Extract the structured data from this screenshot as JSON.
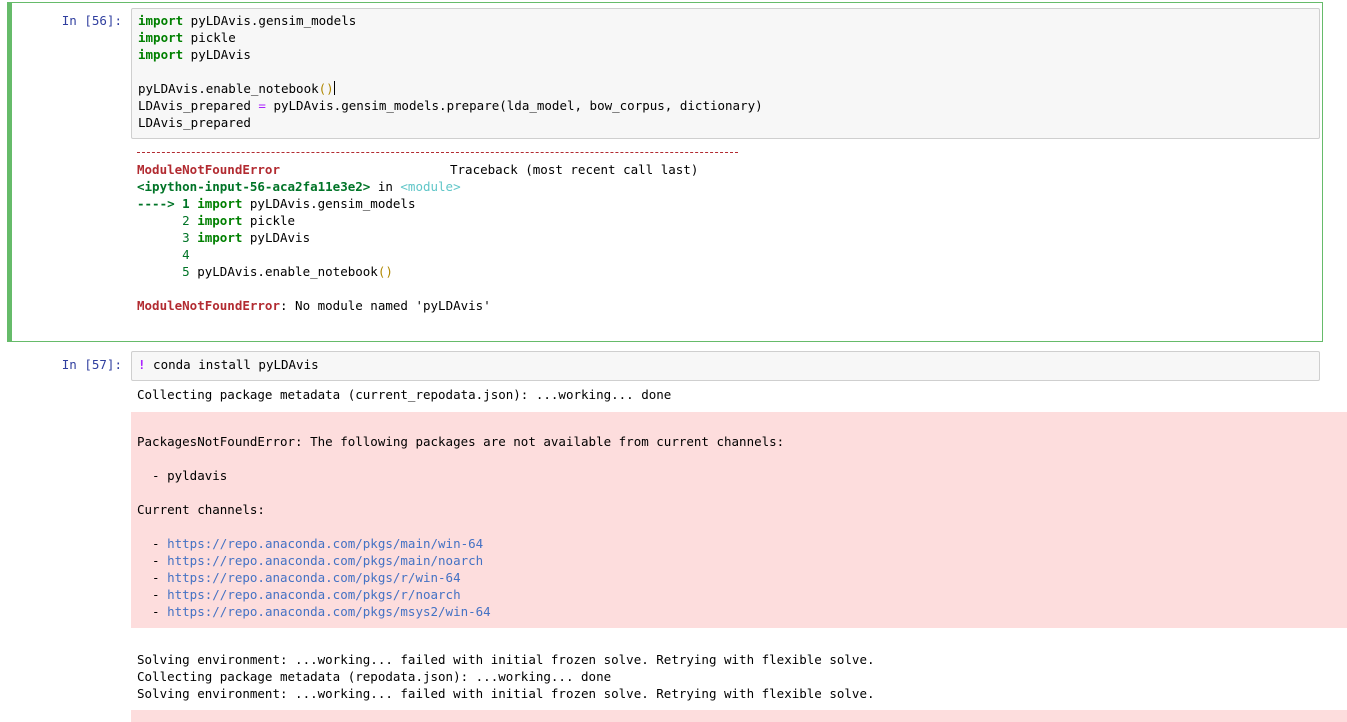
{
  "cell56": {
    "prompt": "In [56]:",
    "code": [
      {
        "kw": "import",
        "rest": " pyLDAvis.gensim_models"
      },
      {
        "kw": "import",
        "rest": " pickle"
      },
      {
        "kw": "import",
        "rest": " pyLDAvis"
      },
      {
        "text": ""
      },
      {
        "pre": "pyLDAvis.enable_notebook",
        "paren": "()"
      },
      {
        "pre": "LDAvis_prepared ",
        "op": "=",
        "post": " pyLDAvis.gensim_models.prepare(lda_model, bow_corpus, dictionary)"
      },
      {
        "text": "LDAvis_prepared"
      }
    ],
    "traceback": {
      "separator": "---------------------------------------------------------------------------",
      "error_name": "ModuleNotFoundError",
      "traceback_label": "Traceback (most recent call last)",
      "input_ref": "<ipython-input-56-aca2fa11e3e2>",
      "in_word": " in ",
      "module": "<module>",
      "lines": [
        {
          "marker": "----> 1 ",
          "kw": "import",
          "rest": " pyLDAvis.gensim_models"
        },
        {
          "marker": "      2 ",
          "kw": "import",
          "rest": " pickle"
        },
        {
          "marker": "      3 ",
          "kw": "import",
          "rest": " pyLDAvis"
        },
        {
          "marker": "      4",
          "kw": "",
          "rest": ""
        },
        {
          "marker": "      5 ",
          "kw": "",
          "rest": "pyLDAvis.enable_notebook",
          "paren": "()"
        }
      ],
      "final_error": "ModuleNotFoundError",
      "final_message": ": No module named 'pyLDAvis'"
    }
  },
  "cell57": {
    "prompt": "In [57]:",
    "bang": "!",
    "command": " conda install pyLDAvis",
    "stdout1": "Collecting package metadata (current_repodata.json): ...working... done",
    "stderr": {
      "title": "PackagesNotFoundError: The following packages are not available from current channels:",
      "package": "  - pyldavis",
      "channels_label": "Current channels:",
      "channel_prefix": "  - ",
      "channels": [
        "https://repo.anaconda.com/pkgs/main/win-64",
        "https://repo.anaconda.com/pkgs/main/noarch",
        "https://repo.anaconda.com/pkgs/r/win-64",
        "https://repo.anaconda.com/pkgs/r/noarch",
        "https://repo.anaconda.com/pkgs/msys2/win-64"
      ]
    },
    "stdout2": [
      "Solving environment: ...working... failed with initial frozen solve. Retrying with flexible solve.",
      "Collecting package metadata (repodata.json): ...working... done",
      "Solving environment: ...working... failed with initial frozen solve. Retrying with flexible solve."
    ]
  }
}
